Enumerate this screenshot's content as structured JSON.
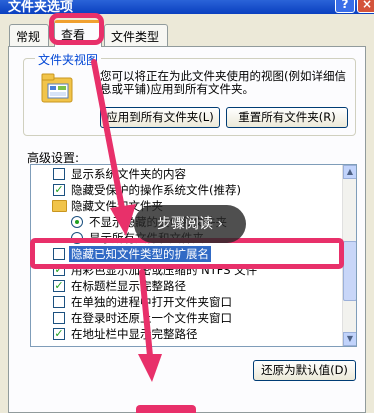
{
  "window": {
    "title": "文件夹选项",
    "help_label": "?",
    "close_label": "×"
  },
  "tabs": [
    {
      "label": "常规"
    },
    {
      "label": "查看"
    },
    {
      "label": "文件类型"
    }
  ],
  "folder_views": {
    "legend": "文件夹视图",
    "description": "您可以将正在为此文件夹使用的视图(例如详细信息或平铺)应用到所有文件夹。",
    "apply_button": "应用到所有文件夹(L)",
    "reset_button": "重置所有文件夹(R)"
  },
  "advanced": {
    "label": "高级设置:",
    "items": [
      {
        "kind": "checkbox",
        "checked": false,
        "label": "显示系统文件夹的内容"
      },
      {
        "kind": "checkbox",
        "checked": true,
        "label": "隐藏受保护的操作系统文件(推荐)"
      },
      {
        "kind": "folder",
        "label": "隐藏文件和文件夹"
      },
      {
        "kind": "radio",
        "checked": true,
        "label": "不显示隐藏的文件和文件夹"
      },
      {
        "kind": "radio",
        "checked": false,
        "label": "显示所有文件和文件夹"
      },
      {
        "kind": "checkbox",
        "checked": false,
        "label": "隐藏已知文件类型的扩展名",
        "selected": true
      },
      {
        "kind": "checkbox",
        "checked": true,
        "label": "用彩色显示加密或压缩的 NTFS 文件"
      },
      {
        "kind": "checkbox",
        "checked": true,
        "label": "在标题栏显示完整路径"
      },
      {
        "kind": "checkbox",
        "checked": false,
        "label": "在单独的进程中打开文件夹窗口"
      },
      {
        "kind": "checkbox",
        "checked": false,
        "label": "在登录时还原上一个文件夹窗口"
      },
      {
        "kind": "checkbox",
        "checked": true,
        "label": "在地址栏中显示完整路径"
      }
    ]
  },
  "restore_button": "还原为默认值(D)",
  "overlay": {
    "tooltip_text": "步骤阅读 ›"
  },
  "colors": {
    "highlight": "#e8306a",
    "selection": "#316ac5",
    "xp_blue": "#0a3fbf"
  }
}
